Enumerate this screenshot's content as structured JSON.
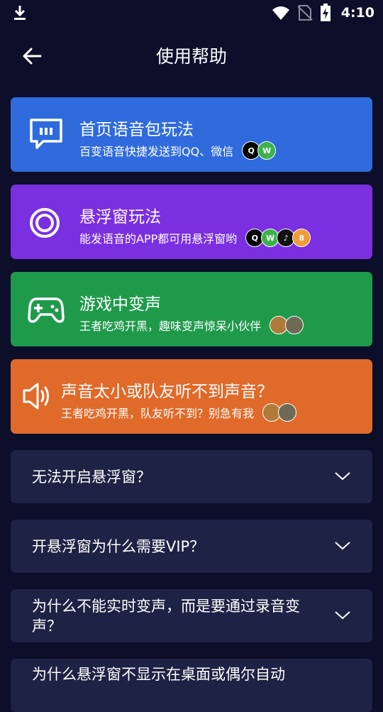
{
  "status_bar": {
    "time": "4:10",
    "icons": [
      "download-icon",
      "wifi-icon",
      "sim-off-icon",
      "battery-charging-icon"
    ]
  },
  "header": {
    "title": "使用帮助",
    "back_icon": "arrow-left-icon"
  },
  "cards": [
    {
      "title": "首页语音包玩法",
      "subtitle": "百变语音快捷发送到QQ、微信",
      "color": "#2f6bdc",
      "icon": "chat-bubble-icon",
      "apps": [
        "qq",
        "wechat"
      ]
    },
    {
      "title": "悬浮窗玩法",
      "subtitle": "能发语音的APP都可用悬浮窗哟",
      "color": "#7a2fe0",
      "icon": "float-window-icon",
      "apps": [
        "qq",
        "wechat",
        "douyin",
        "other"
      ]
    },
    {
      "title": "游戏中变声",
      "subtitle": "王者吃鸡开黑，趣味变声惊呆小伙伴",
      "color": "#1f9a4b",
      "icon": "gamepad-icon",
      "apps": [
        "honor-of-kings",
        "pubg"
      ]
    },
    {
      "title": "声音太小或队友听不到声音？",
      "subtitle": "王者吃鸡开黑，队友听不到？别急有我",
      "color": "#e06a2a",
      "icon": "speaker-icon",
      "apps": [
        "honor-of-kings",
        "pubg"
      ]
    }
  ],
  "faqs": [
    {
      "question": "无法开启悬浮窗？"
    },
    {
      "question": "开悬浮窗为什么需要VIP？"
    },
    {
      "question": "为什么不能实时变声，而是要通过录音变声？"
    },
    {
      "question": "为什么悬浮窗不显示在桌面或偶尔自动"
    }
  ]
}
